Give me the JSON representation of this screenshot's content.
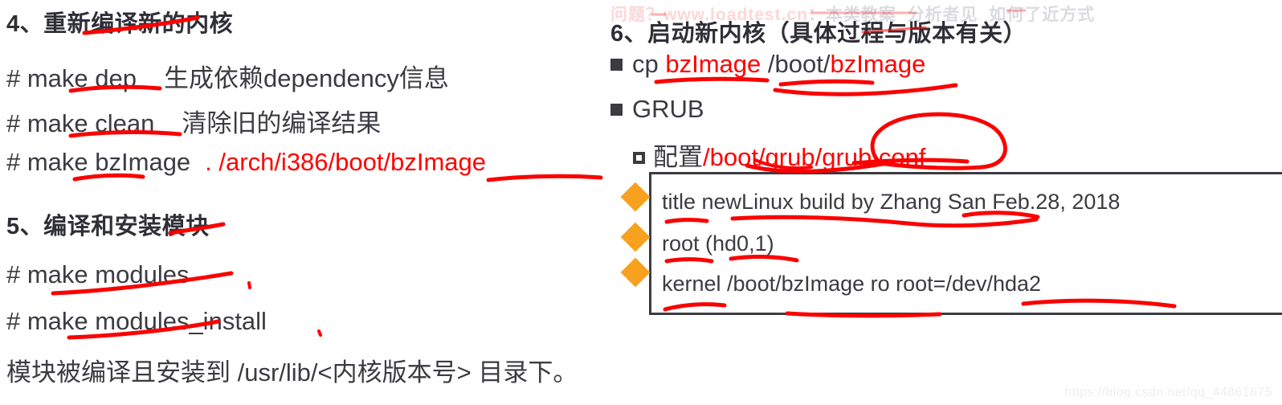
{
  "slide": {
    "watermark": "https://blog.csdn.net/qq_44861675",
    "ghost_header": "问题？www.",
    "accent_red": "#ff0000",
    "text_dark": "#3b3b42",
    "diamond_orange": "#f7a11e"
  },
  "left": {
    "heading_4": "4、重新编译新的内核",
    "cmd_dep_prompt": "# make dep",
    "cmd_dep_note": "生成依赖dependency信息",
    "cmd_clean_prompt": "# make clean",
    "cmd_clean_note": "清除旧的编译结果",
    "cmd_bzimage_prompt": "# make bzImage",
    "cmd_bzimage_path": ". /arch/i386/boot/bzImage",
    "heading_5": "5、编译和安装模块",
    "cmd_modules": "# make modules",
    "cmd_modules_install": "# make modules_install",
    "modules_note": "模块被编译且安装到 /usr/lib/<内核版本号> 目录下。"
  },
  "right": {
    "heading_6": "6、启动新内核（具体过程与版本有关）",
    "cp_cmd": "cp",
    "cp_src": "bzImage",
    "cp_dst_dir": "/boot/",
    "cp_dst_file": "bzImage",
    "grub_label": "GRUB",
    "config_label": "配置",
    "config_path": "/boot/grub/grub.conf",
    "grub_entries": [
      "title newLinux build by Zhang San Feb.28, 2018",
      "root (hd0,1)",
      "kernel /boot/bzImage ro root=/dev/hda2"
    ]
  }
}
